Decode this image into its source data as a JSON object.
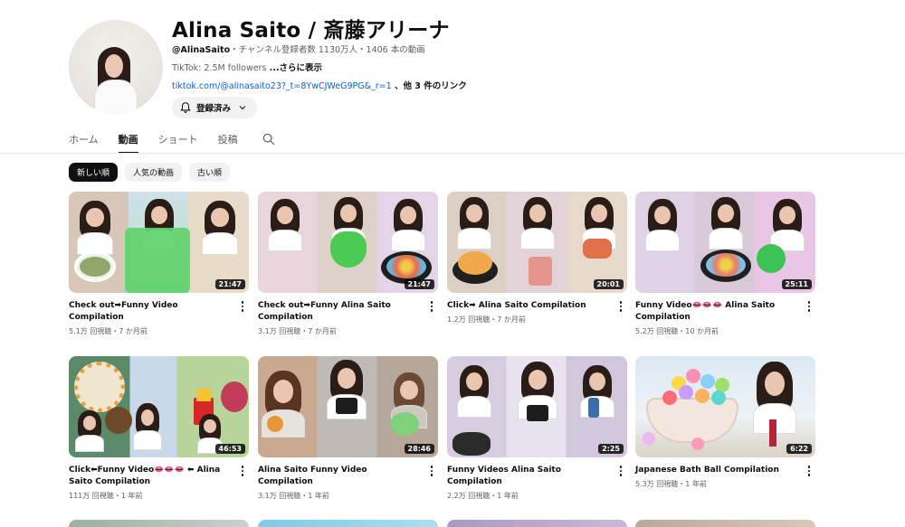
{
  "channel": {
    "name": "Alina Saito / 斎藤アリーナ",
    "handle": "@AlinaSaito",
    "stats": "・チャンネル登録者数 1130万人・1406 本の動画",
    "description": "TikTok: 2.5M followers",
    "more_label": " ...さらに表示",
    "link_url": "tiktok.com/@alinasaito23?_t=8YwCJWeG9PG&_r=1",
    "link_others": " 、他 3 件のリンク",
    "subscribe_label": "登録済み"
  },
  "tabs": [
    "ホーム",
    "動画",
    "ショート",
    "投稿"
  ],
  "active_tab": "動画",
  "chips": [
    "新しい順",
    "人気の動画",
    "古い順"
  ],
  "videos": [
    {
      "title": "Check out➡Funny Video Compilation",
      "stats": "5.1万 回視聴・7 か月前",
      "duration": "21:47"
    },
    {
      "title": "Check out➡Funny Alina Saito Compilation",
      "stats": "3.1万 回視聴・7 か月前",
      "duration": "21:47"
    },
    {
      "title": "Click➡ Alina Saito Compilation",
      "stats": "1.2万 回視聴・7 か月前",
      "duration": "20:01"
    },
    {
      "title": "Funny Video👄👄👄 Alina Saito Compilation",
      "stats": "5.2万 回視聴・10 か月前",
      "duration": "25:11"
    },
    {
      "title": "Click⬅Funny Video👄👄👄 ⬅ Alina Saito Compilation",
      "stats": "111万 回視聴・1 年前",
      "duration": "46:53"
    },
    {
      "title": "Alina Saito Funny Video Compilation",
      "stats": "3.1万 回視聴・1 年前",
      "duration": "28:46"
    },
    {
      "title": "Funny Videos Alina Saito Compilation",
      "stats": "2.2万 回視聴・1 年前",
      "duration": "2:25"
    },
    {
      "title": "Japanese Bath Ball Compilation",
      "stats": "5.3万 回視聴・1 年前",
      "duration": "6:22"
    }
  ],
  "colors": {
    "accent": "#0f0f0f",
    "link": "#065fd4",
    "muted": "#606060",
    "chip_bg": "#f2f2f2"
  },
  "icons": {
    "bell": "bell-icon",
    "chevron": "chevron-down-icon",
    "search": "search-icon",
    "more": "more-vert-icon"
  }
}
